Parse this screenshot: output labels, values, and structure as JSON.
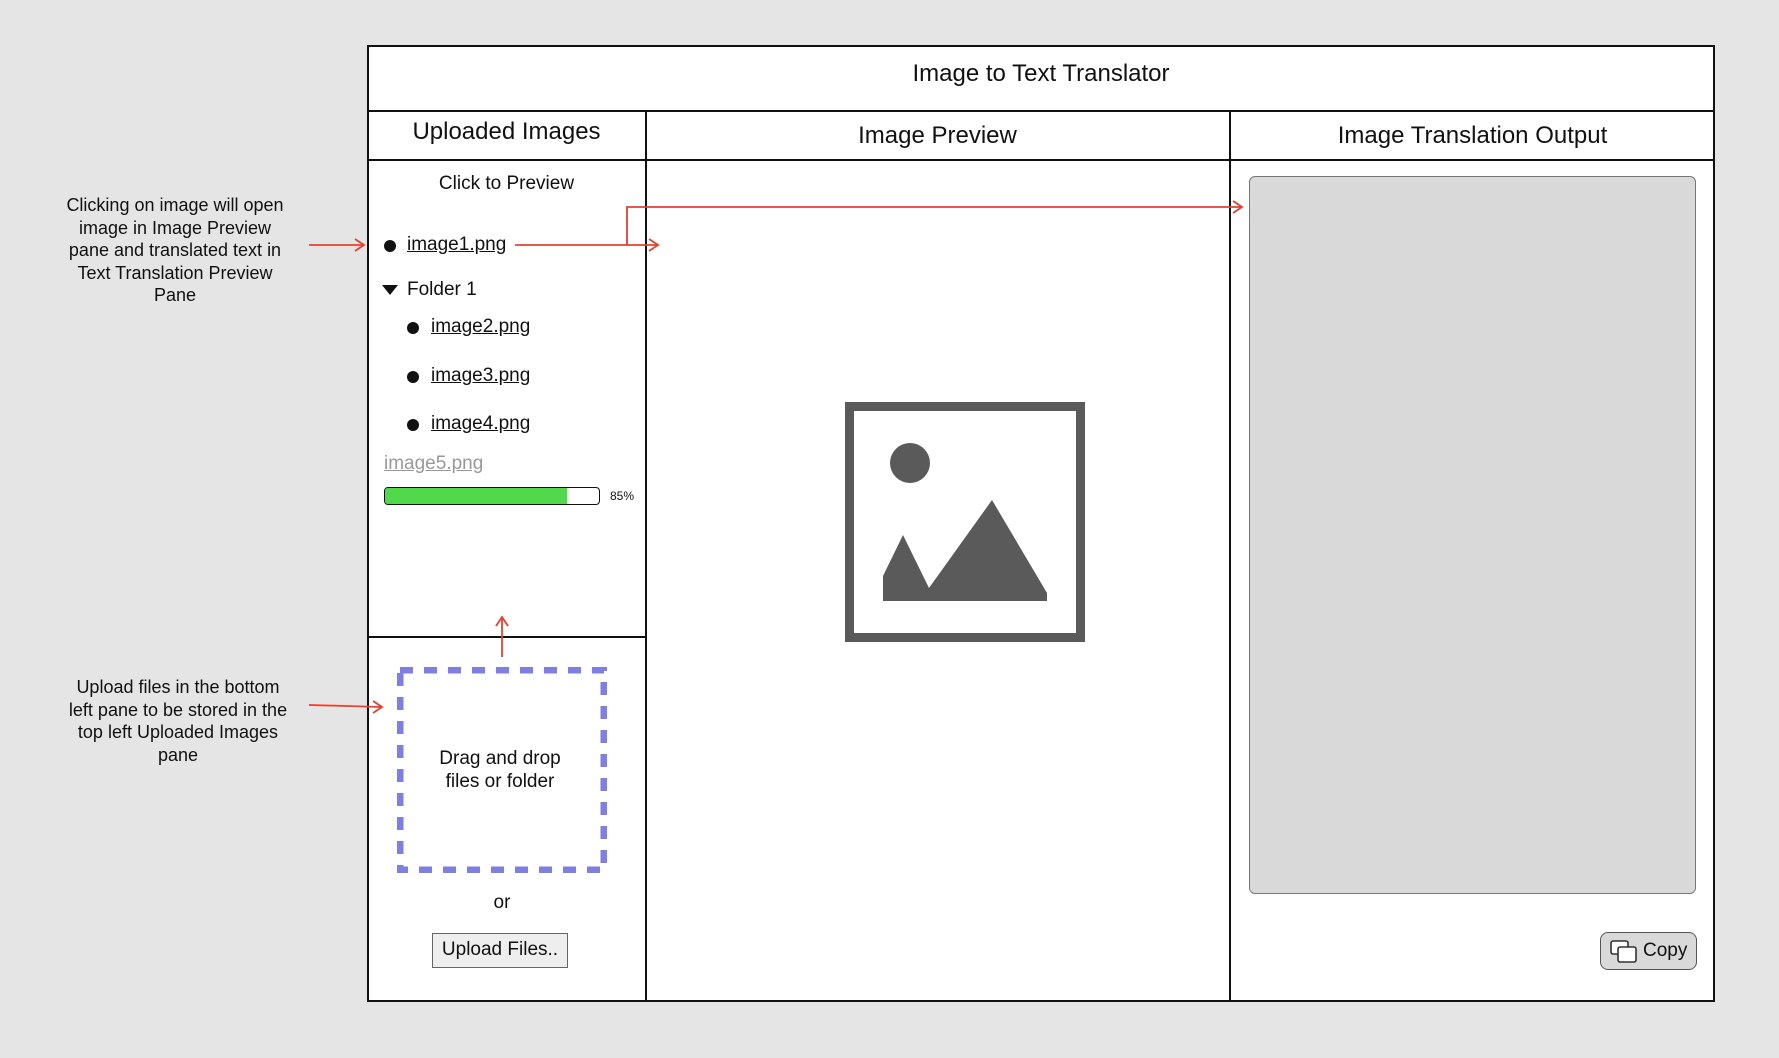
{
  "app": {
    "title": "Image to Text Translator"
  },
  "panes": {
    "uploaded": {
      "title": "Uploaded Images",
      "hint": "Click to Preview"
    },
    "preview": {
      "title": "Image Preview",
      "placeholder_icon": "image-placeholder-icon"
    },
    "output": {
      "title": "Image Translation Output"
    }
  },
  "files": {
    "root_items": [
      {
        "label": "image1.png"
      }
    ],
    "folder": {
      "label": "Folder 1",
      "expanded": true,
      "items": [
        {
          "label": "image2.png"
        },
        {
          "label": "image3.png"
        },
        {
          "label": "image4.png"
        }
      ]
    },
    "uploading": {
      "label": "image5.png",
      "progress": 0.85,
      "progress_label": "85%"
    }
  },
  "upload": {
    "dropzone_text_line1": "Drag and drop",
    "dropzone_text_line2": "files or folder",
    "or_label": "or",
    "button_label": "Upload Files.."
  },
  "copy_button": {
    "label": "Copy",
    "icon": "copy-icon"
  },
  "annotations": {
    "preview_note": [
      "Clicking on image will open",
      "image in Image Preview",
      "pane and translated text in",
      "Text Translation Preview",
      "Pane"
    ],
    "upload_note": [
      "Upload files in the bottom",
      "left pane to be stored in the",
      "top left Uploaded Images",
      "pane"
    ]
  },
  "colors": {
    "accent_arrow": "#e8402a",
    "dropzone_border": "#7d7ee6",
    "progress_fill": "#50d94a",
    "output_bg": "#d9d9d9",
    "icon_gray": "#5a5a5a"
  }
}
